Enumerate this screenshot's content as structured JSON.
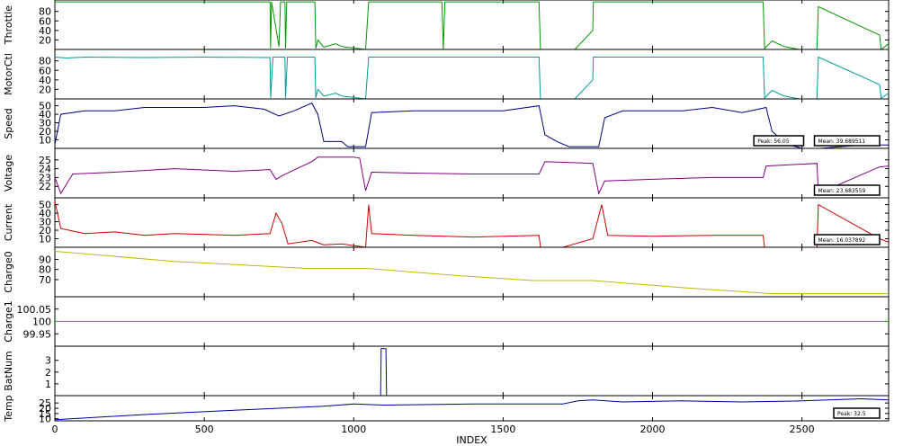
{
  "chart_data": [
    {
      "type": "line",
      "ylabel": "Throttle",
      "color": "#009900",
      "yticks": [
        20,
        40,
        60,
        80
      ],
      "ylim": [
        0,
        104
      ],
      "series": [
        {
          "values": [
            [
              0,
              100
            ],
            [
              720,
              100
            ],
            [
              722,
              2
            ],
            [
              725,
              100
            ],
            [
              750,
              6
            ],
            [
              755,
              100
            ],
            [
              770,
              100
            ],
            [
              772,
              2
            ],
            [
              776,
              100
            ],
            [
              870,
              100
            ],
            [
              873,
              2
            ],
            [
              880,
              20
            ],
            [
              900,
              5
            ],
            [
              940,
              12
            ],
            [
              960,
              6
            ],
            [
              1040,
              0
            ],
            [
              1050,
              100
            ],
            [
              1295,
              100
            ],
            [
              1300,
              0
            ],
            [
              1305,
              100
            ],
            [
              1620,
              100
            ],
            [
              1625,
              0
            ],
            [
              1740,
              0
            ],
            [
              1800,
              40
            ],
            [
              1802,
              100
            ],
            [
              2370,
              100
            ],
            [
              2375,
              2
            ],
            [
              2400,
              18
            ],
            [
              2440,
              6
            ],
            [
              2490,
              0
            ],
            [
              2550,
              0
            ],
            [
              2555,
              90
            ],
            [
              2760,
              30
            ],
            [
              2765,
              0
            ],
            [
              2790,
              12
            ]
          ]
        }
      ]
    },
    {
      "type": "line",
      "ylabel": "MotorCtl",
      "color": "#009999",
      "yticks": [
        20,
        40,
        60,
        80
      ],
      "ylim": [
        0,
        104
      ],
      "series": [
        {
          "values": [
            [
              0,
              88
            ],
            [
              40,
              86
            ],
            [
              100,
              88
            ],
            [
              300,
              87
            ],
            [
              500,
              88
            ],
            [
              720,
              87
            ],
            [
              722,
              2
            ],
            [
              730,
              88
            ],
            [
              770,
              88
            ],
            [
              772,
              2
            ],
            [
              778,
              88
            ],
            [
              870,
              88
            ],
            [
              873,
              2
            ],
            [
              880,
              20
            ],
            [
              900,
              6
            ],
            [
              940,
              12
            ],
            [
              960,
              6
            ],
            [
              1040,
              0
            ],
            [
              1050,
              88
            ],
            [
              1300,
              88
            ],
            [
              1620,
              88
            ],
            [
              1625,
              0
            ],
            [
              1740,
              0
            ],
            [
              1800,
              40
            ],
            [
              1802,
              88
            ],
            [
              2370,
              88
            ],
            [
              2375,
              2
            ],
            [
              2400,
              18
            ],
            [
              2440,
              6
            ],
            [
              2490,
              0
            ],
            [
              2550,
              0
            ],
            [
              2555,
              88
            ],
            [
              2760,
              30
            ],
            [
              2765,
              2
            ],
            [
              2790,
              12
            ]
          ]
        }
      ]
    },
    {
      "type": "line",
      "ylabel": "Speed",
      "color": "#000080",
      "yticks": [
        10,
        20,
        30,
        40,
        50
      ],
      "ylim": [
        0,
        58
      ],
      "series": [
        {
          "values": [
            [
              0,
              5
            ],
            [
              20,
              40
            ],
            [
              100,
              44
            ],
            [
              200,
              44
            ],
            [
              300,
              48
            ],
            [
              400,
              48
            ],
            [
              500,
              48
            ],
            [
              600,
              50
            ],
            [
              700,
              46
            ],
            [
              750,
              38
            ],
            [
              800,
              44
            ],
            [
              860,
              53
            ],
            [
              880,
              40
            ],
            [
              900,
              8
            ],
            [
              960,
              8
            ],
            [
              980,
              2
            ],
            [
              1040,
              2
            ],
            [
              1060,
              42
            ],
            [
              1200,
              44
            ],
            [
              1400,
              44
            ],
            [
              1500,
              44
            ],
            [
              1620,
              50
            ],
            [
              1640,
              16
            ],
            [
              1680,
              8
            ],
            [
              1720,
              2
            ],
            [
              1820,
              2
            ],
            [
              1840,
              36
            ],
            [
              1900,
              44
            ],
            [
              2100,
              44
            ],
            [
              2200,
              48
            ],
            [
              2300,
              42
            ],
            [
              2380,
              48
            ],
            [
              2400,
              20
            ],
            [
              2450,
              5
            ],
            [
              2500,
              0
            ],
            [
              2560,
              0
            ],
            [
              2700,
              4
            ],
            [
              2790,
              4
            ]
          ]
        }
      ],
      "annotations": [
        "Peak: 56.05",
        "Mean: 39.689511"
      ]
    },
    {
      "type": "line",
      "ylabel": "Voltage",
      "color": "#800080",
      "yticks": [
        22,
        23,
        24,
        25
      ],
      "ylim": [
        20.7,
        26.3
      ],
      "series": [
        {
          "values": [
            [
              0,
              23
            ],
            [
              20,
              21.2
            ],
            [
              60,
              23.4
            ],
            [
              200,
              23.6
            ],
            [
              400,
              24
            ],
            [
              600,
              23.7
            ],
            [
              720,
              23.9
            ],
            [
              740,
              22.8
            ],
            [
              760,
              23.2
            ],
            [
              860,
              24.8
            ],
            [
              880,
              25.3
            ],
            [
              1000,
              25.3
            ],
            [
              1020,
              25.2
            ],
            [
              1040,
              21.5
            ],
            [
              1060,
              23.6
            ],
            [
              1200,
              23.5
            ],
            [
              1400,
              23.4
            ],
            [
              1620,
              23.4
            ],
            [
              1640,
              24.8
            ],
            [
              1800,
              24.6
            ],
            [
              1820,
              21.2
            ],
            [
              1840,
              22.6
            ],
            [
              2000,
              22.8
            ],
            [
              2200,
              23
            ],
            [
              2370,
              23
            ],
            [
              2380,
              24.3
            ],
            [
              2550,
              24.6
            ],
            [
              2555,
              21.2
            ],
            [
              2760,
              24.2
            ],
            [
              2790,
              24.3
            ]
          ]
        }
      ],
      "annotations": [
        "Mean: 23.683559"
      ]
    },
    {
      "type": "line",
      "ylabel": "Current",
      "color": "#cc0000",
      "yticks": [
        10,
        20,
        30,
        40,
        50
      ],
      "ylim": [
        0,
        58
      ],
      "series": [
        {
          "values": [
            [
              0,
              54
            ],
            [
              20,
              22
            ],
            [
              100,
              16
            ],
            [
              200,
              18
            ],
            [
              300,
              14
            ],
            [
              400,
              16
            ],
            [
              600,
              14
            ],
            [
              720,
              16
            ],
            [
              740,
              40
            ],
            [
              760,
              28
            ],
            [
              780,
              4
            ],
            [
              860,
              8
            ],
            [
              900,
              3
            ],
            [
              960,
              4
            ],
            [
              1040,
              0
            ],
            [
              1050,
              50
            ],
            [
              1060,
              16
            ],
            [
              1200,
              14
            ],
            [
              1400,
              12
            ],
            [
              1620,
              14
            ],
            [
              1625,
              0
            ],
            [
              1700,
              0
            ],
            [
              1800,
              10
            ],
            [
              1830,
              50
            ],
            [
              1850,
              14
            ],
            [
              2000,
              13
            ],
            [
              2200,
              14
            ],
            [
              2370,
              14
            ],
            [
              2375,
              0
            ],
            [
              2550,
              0
            ],
            [
              2555,
              50
            ],
            [
              2760,
              10
            ],
            [
              2790,
              6
            ]
          ]
        }
      ],
      "annotations": [
        "Mean: 16.037892"
      ]
    },
    {
      "type": "line",
      "ylabel": "Charge0",
      "color": "#bbbb00",
      "yticks": [
        70,
        80,
        90
      ],
      "ylim": [
        53,
        102
      ],
      "series": [
        {
          "values": [
            [
              0,
              98
            ],
            [
              400,
              88
            ],
            [
              850,
              81
            ],
            [
              1050,
              81
            ],
            [
              1300,
              75
            ],
            [
              1600,
              69
            ],
            [
              1800,
              69
            ],
            [
              2100,
              62
            ],
            [
              2400,
              56
            ],
            [
              2790,
              56
            ]
          ]
        }
      ]
    },
    {
      "type": "line",
      "ylabel": "Charge1",
      "color": "#00cc00",
      "yticks": [
        99.95,
        100,
        100.05
      ],
      "ytick_labels": [
        "99.95",
        "100",
        "100.05"
      ],
      "ylim": [
        99.9,
        100.1
      ],
      "series": [
        {
          "values": [
            [
              0,
              100
            ],
            [
              2790,
              100
            ]
          ]
        }
      ]
    },
    {
      "type": "line",
      "ylabel": "BatNum",
      "color": "#0000cc",
      "yticks": [
        1,
        2,
        3
      ],
      "ylim": [
        0,
        4.2
      ],
      "series": [
        {
          "values": [
            [
              0,
              0
            ],
            [
              1090,
              0
            ],
            [
              1092,
              4
            ],
            [
              1108,
              4
            ],
            [
              1110,
              0
            ],
            [
              2790,
              0
            ]
          ]
        }
      ]
    },
    {
      "type": "line",
      "ylabel": "Temp",
      "color": "#000099",
      "yticks": [
        10,
        15,
        20,
        25
      ],
      "ylim": [
        8,
        32
      ],
      "series": [
        {
          "values": [
            [
              0,
              9
            ],
            [
              300,
              14
            ],
            [
              600,
              18
            ],
            [
              900,
              22
            ],
            [
              1000,
              24
            ],
            [
              1100,
              23
            ],
            [
              1400,
              24
            ],
            [
              1700,
              24
            ],
            [
              1750,
              27
            ],
            [
              1800,
              28
            ],
            [
              1900,
              26
            ],
            [
              2100,
              27
            ],
            [
              2300,
              26
            ],
            [
              2500,
              27
            ],
            [
              2700,
              29
            ],
            [
              2790,
              28
            ]
          ]
        }
      ],
      "annotations": [
        "Peak: 32.5"
      ]
    }
  ],
  "xaxis": {
    "label": "INDEX",
    "ticks": [
      0,
      500,
      1000,
      1500,
      2000,
      2500
    ],
    "xlim": [
      0,
      2790
    ]
  }
}
